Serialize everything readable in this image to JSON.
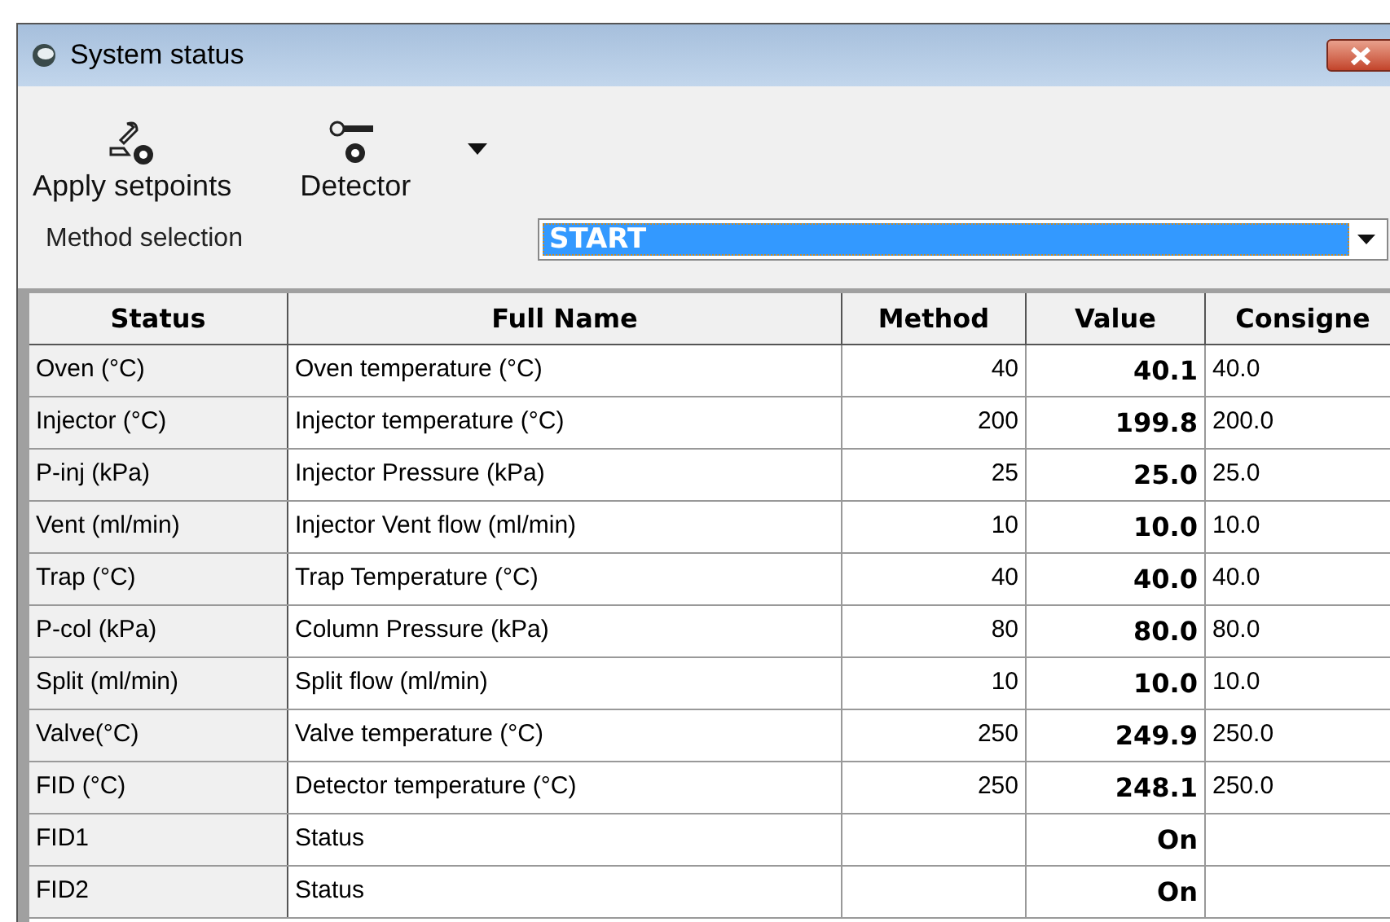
{
  "window": {
    "title": "System status"
  },
  "toolbar": [
    {
      "label": "Apply setpoints",
      "kind": "setpoints"
    },
    {
      "label": "Detector",
      "kind": "detector"
    }
  ],
  "method_selection": {
    "label": "Method selection",
    "value": "START"
  },
  "table": {
    "columns": [
      "Status",
      "Full Name",
      "Method",
      "Value",
      "Consigne"
    ],
    "rows": [
      [
        "Oven (°C)",
        "Oven temperature (°C)",
        "40",
        "40.1",
        "40.0"
      ],
      [
        "Injector (°C)",
        "Injector temperature (°C)",
        "200",
        "199.8",
        "200.0"
      ],
      [
        "P-inj (kPa)",
        "Injector Pressure (kPa)",
        "25",
        "25.0",
        "25.0"
      ],
      [
        "Vent (ml/min)",
        "Injector Vent flow (ml/min)",
        "10",
        "10.0",
        "10.0"
      ],
      [
        "Trap (°C)",
        "Trap Temperature (°C)",
        "40",
        "40.0",
        "40.0"
      ],
      [
        "P-col (kPa)",
        "Column Pressure (kPa)",
        "80",
        "80.0",
        "80.0"
      ],
      [
        "Split (ml/min)",
        "Split flow (ml/min)",
        "10",
        "10.0",
        "10.0"
      ],
      [
        "Valve(°C)",
        "Valve temperature (°C)",
        "250",
        "249.9",
        "250.0"
      ],
      [
        "FID (°C)",
        "Detector temperature (°C)",
        "250",
        "248.1",
        "250.0"
      ],
      [
        "FID1",
        "Status",
        null,
        "On",
        null
      ],
      [
        "FID2",
        "Status",
        null,
        "On",
        null
      ]
    ]
  }
}
